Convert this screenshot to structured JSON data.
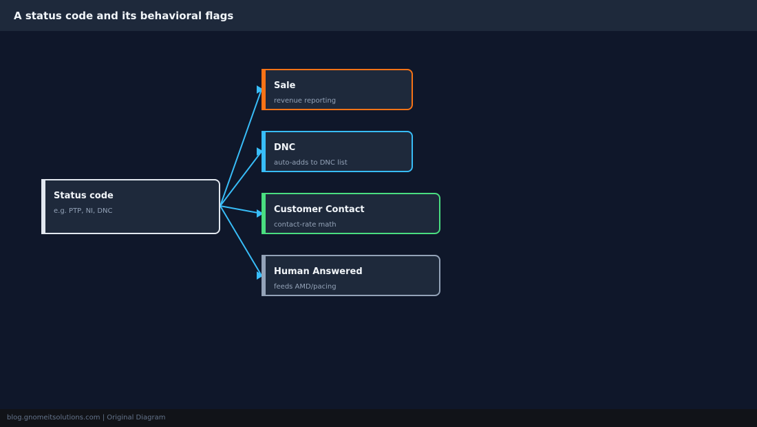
{
  "header": {
    "title": "A status code and its behavioral flags"
  },
  "source": {
    "title": "Status code",
    "subtitle": "e.g. PTP, NI, DNC",
    "color": "#e2e8f0"
  },
  "flags": [
    {
      "title": "Sale",
      "subtitle": "revenue reporting",
      "color": "#f97316"
    },
    {
      "title": "DNC",
      "subtitle": "auto-adds to DNC list",
      "color": "#38bdf8"
    },
    {
      "title": "Customer Contact",
      "subtitle": "contact-rate math",
      "color": "#4ade80"
    },
    {
      "title": "Human Answered",
      "subtitle": "feeds AMD/pacing",
      "color": "#94a3b8"
    }
  ],
  "edge_color": "#38bdf8",
  "footer": {
    "text": "blog.gnomeitsolutions.com | Original Diagram"
  }
}
